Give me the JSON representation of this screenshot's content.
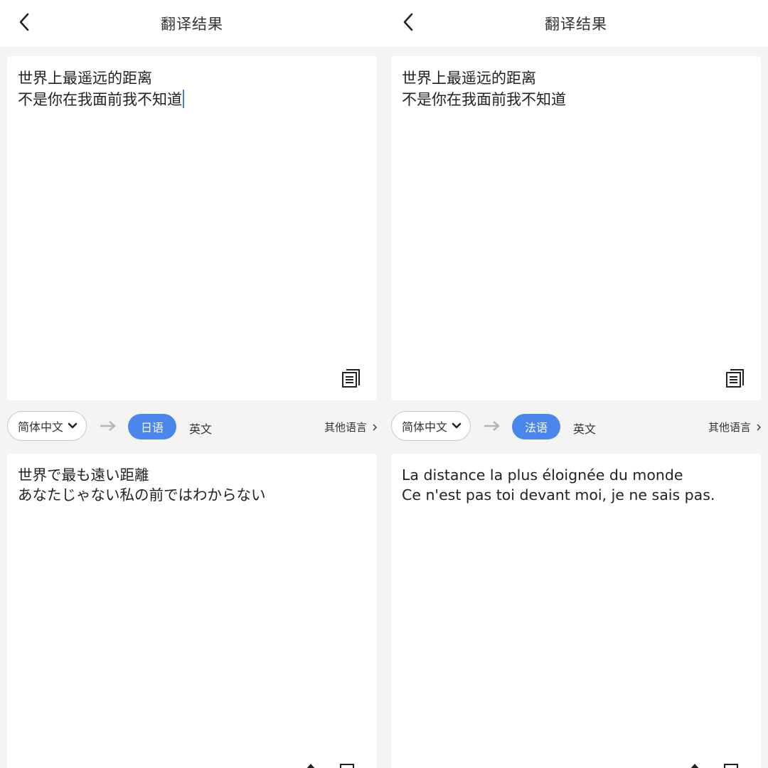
{
  "panels": [
    {
      "header": {
        "title": "翻译结果"
      },
      "source": {
        "lines": [
          "世界上最遥远的距离",
          "不是你在我面前我不知道"
        ]
      },
      "langbar": {
        "source_lang": "简体中文",
        "target_lang": "日语",
        "alt_lang": "英文",
        "other": "其他语言"
      },
      "target": {
        "lines": [
          "世界で最も遠い距離",
          "あなたじゃない私の前ではわからない"
        ]
      }
    },
    {
      "header": {
        "title": "翻译结果"
      },
      "source": {
        "lines": [
          "世界上最遥远的距离",
          "不是你在我面前我不知道"
        ]
      },
      "langbar": {
        "source_lang": "简体中文",
        "target_lang": "法语",
        "alt_lang": "英文",
        "other": "其他语言"
      },
      "target": {
        "lines": [
          "La distance la plus éloignée du monde",
          "Ce n'est pas toi devant moi, je ne sais pas."
        ]
      }
    }
  ],
  "colors": {
    "accent": "#4a86ec",
    "background": "#f4f4f4",
    "card": "#ffffff"
  },
  "icons": [
    "back-arrow-icon",
    "copy-icon",
    "chevron-down-icon",
    "arrow-right-icon",
    "chevron-right-icon"
  ]
}
